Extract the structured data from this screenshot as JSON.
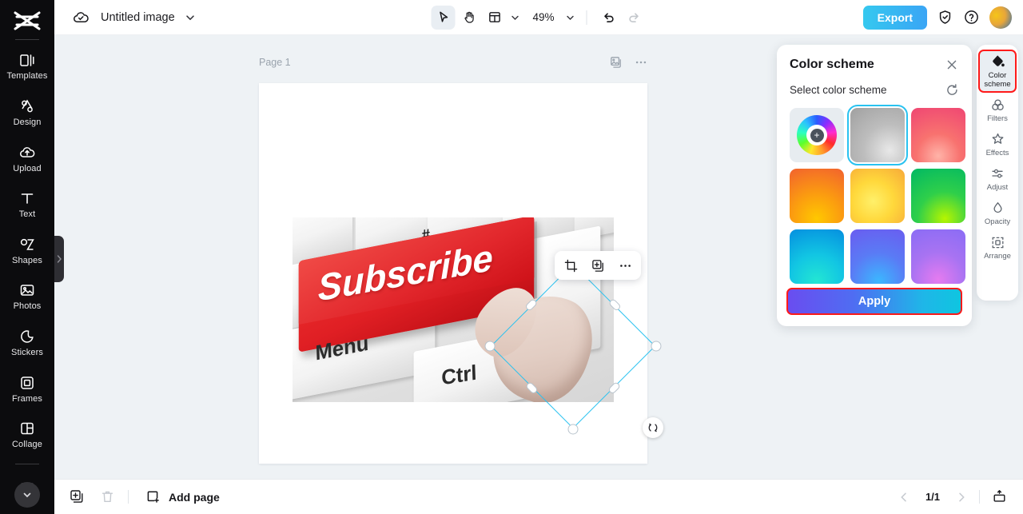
{
  "app": {
    "document_title": "Untitled image",
    "zoom_level": "49%"
  },
  "left_rail": {
    "logo_name": "capcut-logo-icon",
    "items": [
      {
        "label": "Templates",
        "icon": "templates-icon"
      },
      {
        "label": "Design",
        "icon": "design-icon"
      },
      {
        "label": "Upload",
        "icon": "upload-cloud-icon"
      },
      {
        "label": "Text",
        "icon": "text-icon"
      },
      {
        "label": "Shapes",
        "icon": "shapes-icon"
      },
      {
        "label": "Photos",
        "icon": "photos-icon"
      },
      {
        "label": "Stickers",
        "icon": "stickers-icon"
      },
      {
        "label": "Frames",
        "icon": "frames-icon"
      },
      {
        "label": "Collage",
        "icon": "collage-icon"
      }
    ],
    "expand_more_icon": "chevron-down-icon",
    "collapse_handle_icon": "chevron-right-icon"
  },
  "top_bar": {
    "cloud_icon": "cloud-saved-icon",
    "title_caret_icon": "chevron-down-icon",
    "tools": [
      {
        "name": "select-tool",
        "icon": "cursor-arrow-icon",
        "active": true
      },
      {
        "name": "hand-tool",
        "icon": "hand-icon",
        "active": false
      },
      {
        "name": "layout-tool",
        "icon": "layout-grid-icon",
        "active": false
      }
    ],
    "layout_caret_icon": "chevron-down-icon",
    "zoom_caret_icon": "chevron-down-icon",
    "undo_icon": "undo-arrow-icon",
    "redo_icon": "redo-arrow-icon",
    "export_label": "Export",
    "shield_icon": "shield-check-icon",
    "help_icon": "question-circle-icon",
    "avatar_name": "user-avatar"
  },
  "canvas": {
    "page_label": "Page 1",
    "page_actions": [
      {
        "name": "duplicate-page-icon"
      },
      {
        "name": "page-more-options-icon"
      }
    ],
    "photo": {
      "alt": "Red Subscribe key on a computer keyboard with a pointing hand",
      "key_word": "Subscribe",
      "menu_key": "Menu",
      "ctrl_key": "Ctrl",
      "hash_key": "#"
    },
    "element_toolbar": [
      {
        "name": "crop-icon"
      },
      {
        "name": "duplicate-icon"
      },
      {
        "name": "more-options-icon"
      }
    ],
    "selection": {
      "rotate_icon": "rotate-icon",
      "accent_color": "#29c2f0"
    }
  },
  "color_panel": {
    "title": "Color scheme",
    "close_icon": "close-icon",
    "subtitle": "Select color scheme",
    "reset_icon": "reset-icon",
    "custom_swatch_icon": "color-wheel-add-icon",
    "swatches": [
      {
        "name": "custom",
        "selected": false,
        "css": ""
      },
      {
        "name": "grey",
        "selected": true,
        "css": "radial-gradient(circle at 72% 78%, #e8e8e8 0%, #bdbdbd 45%, #a0a0a0 100%)"
      },
      {
        "name": "pink",
        "selected": false,
        "css": "radial-gradient(circle at 50% 88%, #ffb3a8 0%, #f8726f 40%, #ef4673 100%)"
      },
      {
        "name": "orange",
        "selected": false,
        "css": "radial-gradient(circle at 50% 92%, #ffc800 0%, #fb9b10 45%, #f2622e 100%)"
      },
      {
        "name": "yellow",
        "selected": false,
        "css": "radial-gradient(circle at 42% 60%, #fff06a 0%, #ffd83b 45%, #f7a93a 100%)"
      },
      {
        "name": "green",
        "selected": false,
        "css": "radial-gradient(circle at 62% 92%, #b6f500 0%, #2fcf4a 45%, #00b864 100%)"
      },
      {
        "name": "cyan",
        "selected": false,
        "css": "radial-gradient(circle at 50% 95%, #23e6d3 0%, #12c6e3 45%, #058fe0 100%)"
      },
      {
        "name": "blue-violet",
        "selected": false,
        "css": "radial-gradient(circle at 52% 95%, #3bb7ff 0%, #5a7bf5 48%, #6a5cf0 100%)"
      },
      {
        "name": "purple",
        "selected": false,
        "css": "radial-gradient(circle at 50% 92%, #e57bf0 0%, #a873f2 48%, #8a6cf5 100%)"
      }
    ],
    "apply_label": "Apply",
    "apply_highlight_color": "#ff1a1a"
  },
  "right_rail": {
    "items": [
      {
        "label": "Color\nscheme",
        "label_line1": "Color",
        "label_line2": "scheme",
        "icon": "color-scheme-icon",
        "active": true
      },
      {
        "label": "Filters",
        "icon": "filters-icon",
        "active": false
      },
      {
        "label": "Effects",
        "icon": "effects-icon",
        "active": false
      },
      {
        "label": "Adjust",
        "icon": "adjust-icon",
        "active": false
      },
      {
        "label": "Opacity",
        "icon": "opacity-icon",
        "active": false
      },
      {
        "label": "Arrange",
        "icon": "arrange-icon",
        "active": false
      }
    ],
    "active_highlight_color": "#ff1a1a"
  },
  "bottom_bar": {
    "duplicate_icon": "duplicate-page-icon",
    "delete_icon": "trash-icon",
    "add_page_label": "Add page",
    "add_page_icon": "add-page-icon",
    "prev_icon": "chevron-left-icon",
    "page_indicator": "1/1",
    "next_icon": "chevron-right-icon",
    "present_icon": "present-icon"
  }
}
